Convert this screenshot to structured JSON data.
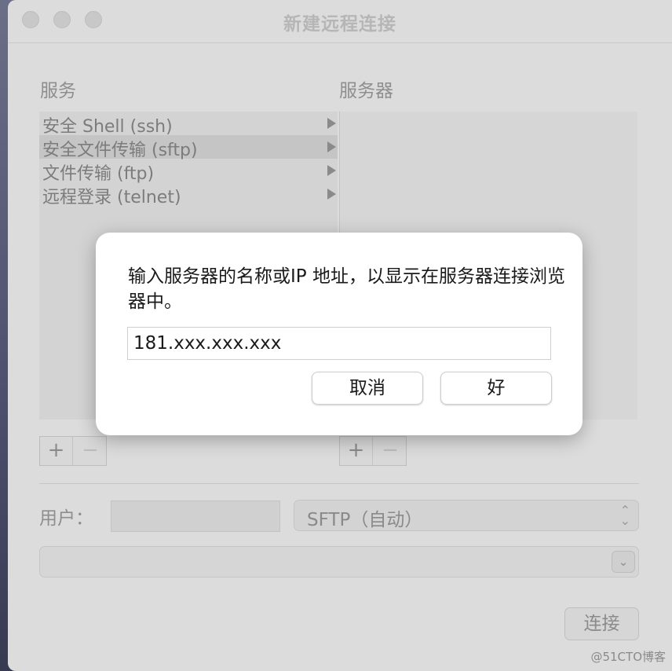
{
  "window": {
    "title": "新建远程连接"
  },
  "columns": {
    "services_label": "服务",
    "servers_label": "服务器"
  },
  "services": [
    {
      "label": "安全 Shell (ssh)",
      "selected": false
    },
    {
      "label": "安全文件传输 (sftp)",
      "selected": true
    },
    {
      "label": "文件传输 (ftp)",
      "selected": false
    },
    {
      "label": "远程登录 (telnet)",
      "selected": false
    }
  ],
  "controls": {
    "plus": "+",
    "minus": "−"
  },
  "user": {
    "label": "用户：",
    "value": ""
  },
  "protocol": {
    "selected": "SFTP（自动）"
  },
  "connect_label": "连接",
  "dialog": {
    "message": "输入服务器的名称或IP 地址，以显示在服务器连接浏览器中。",
    "input_value": "181.xxx.xxx.xxx",
    "cancel_label": "取消",
    "ok_label": "好"
  },
  "watermark": "@51CTO博客"
}
